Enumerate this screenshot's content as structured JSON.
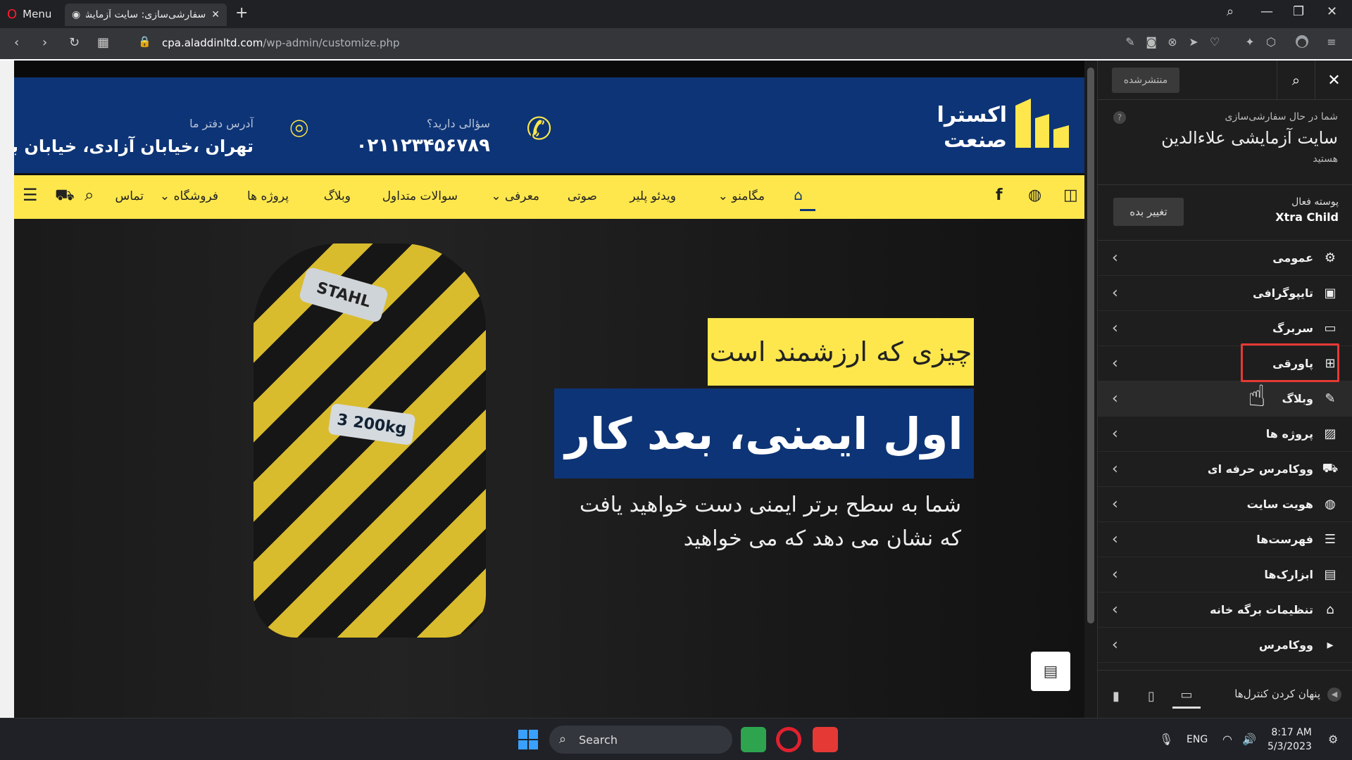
{
  "browser": {
    "menu_label": "Menu",
    "tab_title": "سفارشی‌سازی: سایت آزمایشی علاءالدین",
    "url_host": "cpa.aladdinltd.com",
    "url_path": "/wp-admin/customize.php"
  },
  "site": {
    "logo_line1": "اکسترا",
    "logo_line2": "صنعت",
    "phone_label": "سؤالی دارید؟",
    "phone_value": "۰۲۱۱۲۳۴۵۶۷۸۹",
    "address_label": "آدرس دفتر ما",
    "address_value": "تهران ،خیابان آزادی، خیابان بهبودی",
    "nav": [
      "مگامنو",
      "ویدئو پلیر",
      "صوتی",
      "معرفی",
      "سوالات متداول",
      "وبلاگ",
      "پروژه ها",
      "فروشگاه",
      "تماس"
    ],
    "hero_tag": "چیزی که ارزشمند است",
    "hero_title": "اول ایمنی، بعد کار",
    "hero_sub_line1": "شما به سطح برتر ایمنی دست خواهید یافت",
    "hero_sub_line2": "که نشان می دهد که می خواهید",
    "hook_label": "STAHL",
    "hook_weight": "3 200kg"
  },
  "customizer": {
    "published_label": "منتشرشده",
    "customizing_label": "شما در حال سفارشی‌سازی",
    "site_name": "سایت آزمایشی علاءالدین",
    "site_suffix": "هستید",
    "active_theme_label": "پوسته فعال",
    "active_theme_name": "Xtra Child",
    "change_theme_label": "تغییر بده",
    "sections": [
      {
        "label": "عمومی",
        "icon": "gear-icon"
      },
      {
        "label": "تایپوگرافی",
        "icon": "typography-icon"
      },
      {
        "label": "سربرگ",
        "icon": "header-icon"
      },
      {
        "label": "پاورقی",
        "icon": "sitemap-icon"
      },
      {
        "label": "وبلاگ",
        "icon": "pencil-icon"
      },
      {
        "label": "پروژه ها",
        "icon": "portfolio-icon"
      },
      {
        "label": "ووکامرس حرفه ای",
        "icon": "cart-icon"
      },
      {
        "label": "هویت سایت",
        "icon": "globe-icon"
      },
      {
        "label": "فهرست‌ها",
        "icon": "menu-icon"
      },
      {
        "label": "ابزارک‌ها",
        "icon": "widgets-icon"
      },
      {
        "label": "تنظیمات برگه خانه",
        "icon": "home-icon"
      },
      {
        "label": "ووکامرس",
        "icon": "woocommerce-icon"
      }
    ],
    "hide_controls_label": "پنهان کردن کنترل‌ها"
  },
  "taskbar": {
    "search_label": "Search",
    "lang": "ENG",
    "time": "8:17 AM",
    "date": "5/3/2023"
  }
}
